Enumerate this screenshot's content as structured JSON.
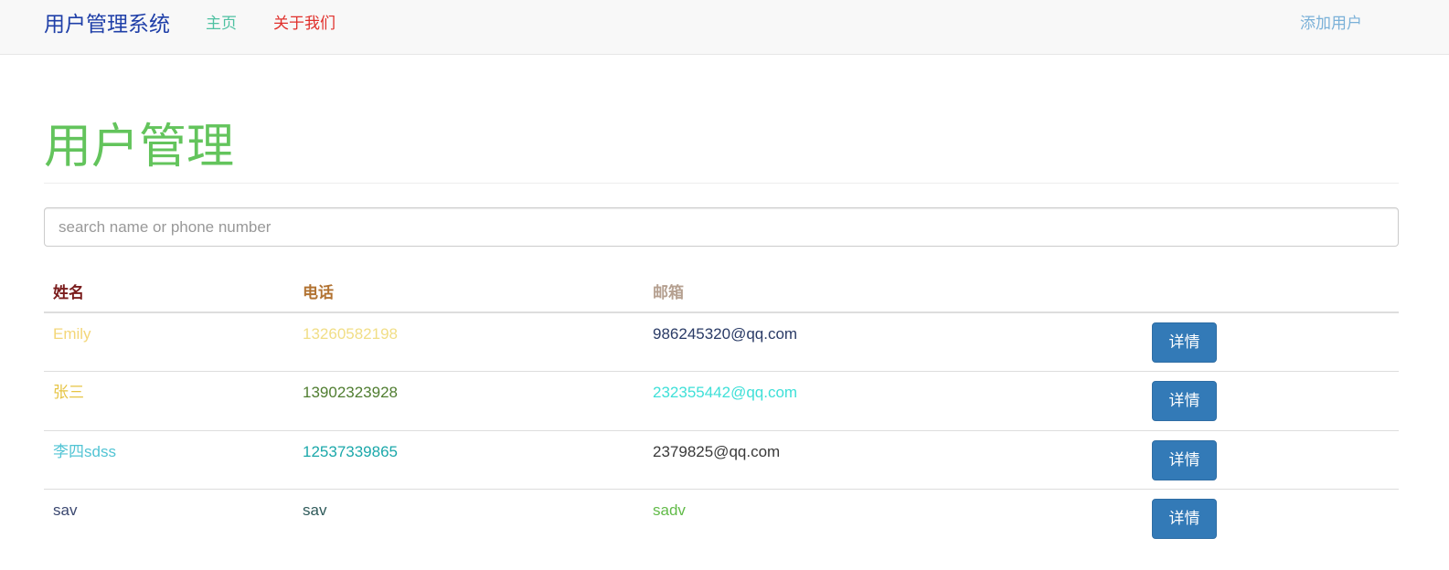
{
  "navbar": {
    "brand": "用户管理系统",
    "links": [
      {
        "label": "主页",
        "color": "#4fc1a2"
      },
      {
        "label": "关于我们",
        "color": "#e0302b"
      }
    ],
    "add_user": "添加用户",
    "brand_color": "#1f3fa8",
    "add_user_color": "#7bb1d8"
  },
  "page": {
    "title": "用户管理",
    "title_color": "#63c45c"
  },
  "search": {
    "value": "",
    "placeholder": "search name or phone number"
  },
  "table": {
    "headers": [
      {
        "label": "姓名",
        "color": "#7a1c1c"
      },
      {
        "label": "电话",
        "color": "#b27332"
      },
      {
        "label": "邮箱",
        "color": "#b5a090"
      },
      {
        "label": "",
        "color": "#333333"
      }
    ],
    "rows": [
      {
        "name": {
          "text": "Emily",
          "color": "#f3d678"
        },
        "phone": {
          "text": "13260582198",
          "color": "#f1de86"
        },
        "email": {
          "text": "986245320@qq.com",
          "color": "#2a3b66"
        },
        "action": "详情"
      },
      {
        "name": {
          "text": "张三",
          "color": "#e6c444"
        },
        "phone": {
          "text": "13902323928",
          "color": "#4f7d30"
        },
        "email": {
          "text": "232355442@qq.com",
          "color": "#3fe0d8"
        },
        "action": "详情"
      },
      {
        "name": {
          "text": "李四sdss",
          "color": "#52c4d4"
        },
        "phone": {
          "text": "12537339865",
          "color": "#1ba8aa"
        },
        "email": {
          "text": "2379825@qq.com",
          "color": "#3a3a3a"
        },
        "action": "详情"
      },
      {
        "name": {
          "text": "sav",
          "color": "#3b4870"
        },
        "phone": {
          "text": "sav",
          "color": "#2f5a5a"
        },
        "email": {
          "text": "sadv",
          "color": "#62bb49"
        },
        "action": "详情"
      }
    ]
  }
}
